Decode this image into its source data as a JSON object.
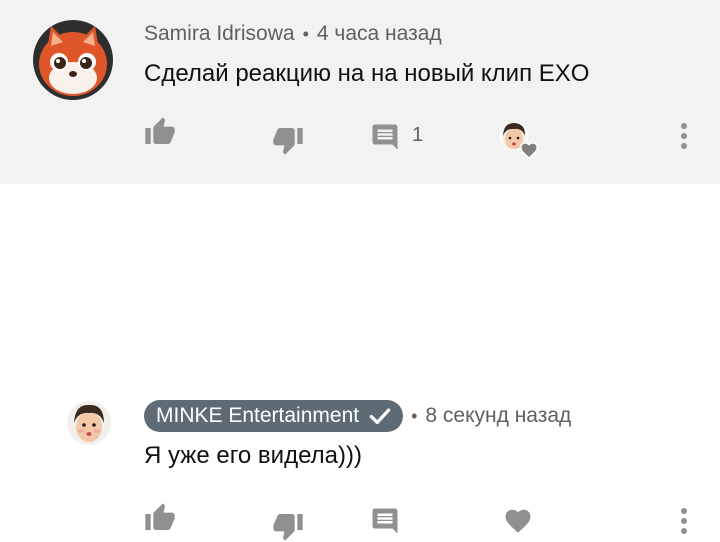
{
  "comment": {
    "author": "Samira Idrisowa",
    "separator": "•",
    "time": "4 часа назад",
    "text": "Сделай реакцию на на новый клип EXO",
    "reply_count": "1",
    "icons": {
      "avatar": "fox-avatar",
      "like": "thumbs-up-icon",
      "dislike": "thumbs-down-icon",
      "reply": "reply-icon",
      "creator_heart": "creator-heart-icon",
      "more": "more-vert-icon"
    }
  },
  "reply": {
    "author": "MINKE Entertainment",
    "separator": "•",
    "time": "8 секунд назад",
    "text": "Я уже его видела)))",
    "icons": {
      "avatar": "channel-avatar",
      "verified": "verified-check-icon",
      "like": "thumbs-up-icon",
      "dislike": "thumbs-down-icon",
      "reply": "reply-icon",
      "heart": "heart-icon",
      "more": "more-vert-icon"
    }
  },
  "colors": {
    "top_background": "#f2f2f2",
    "reply_background": "#ffffff",
    "meta_text": "#606060",
    "body_text": "#111111",
    "icon": "#909090",
    "badge_background": "#5f6b74"
  }
}
